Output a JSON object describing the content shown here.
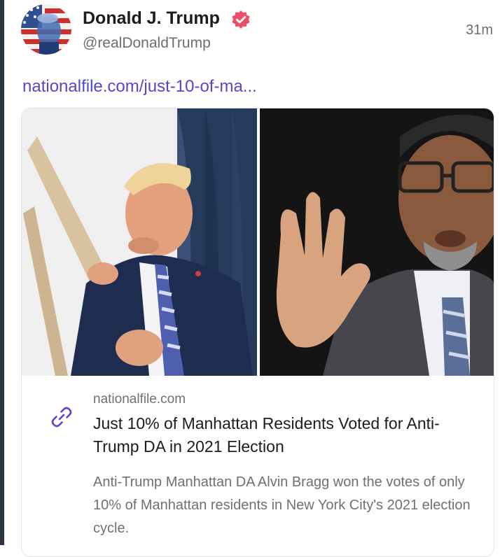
{
  "post": {
    "author_name": "Donald J. Trump",
    "author_handle": "@realDonaldTrump",
    "timestamp": "31m",
    "link_text": "nationalfile.com/just-10-of-ma..."
  },
  "card": {
    "domain": "nationalfile.com",
    "title": "Just 10% of Manhattan Residents Voted for Anti-Trump DA in 2021 Election",
    "description": "Anti-Trump Manhattan DA Alvin Bragg won the votes of only 10% of Manhattan residents in New York City's 2021 election cycle."
  },
  "colors": {
    "link": "#5448c8",
    "verified_badge": "#e8506a",
    "secondary_text": "#6d6d73"
  },
  "icons": {
    "verified": "verified-badge-icon",
    "link": "link-chain-icon"
  }
}
